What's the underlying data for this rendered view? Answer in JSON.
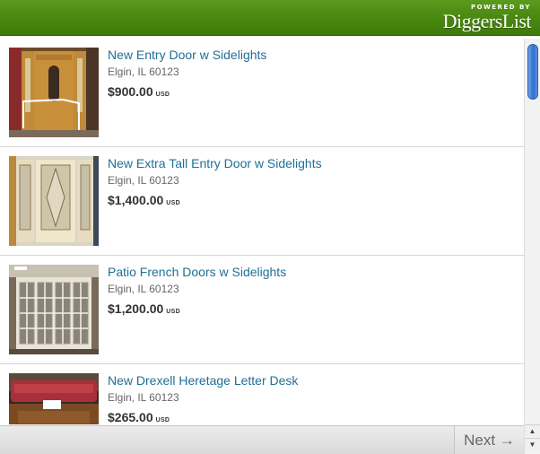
{
  "header": {
    "powered_by": "POWERED BY",
    "logo_text": "DiggersList",
    "bg_color": "#4b8a12"
  },
  "listings": [
    {
      "title": "New Entry Door w Sidelights",
      "location": "Elgin, IL 60123",
      "price": "$900.00",
      "currency": "USD",
      "image": "entry-door-photo"
    },
    {
      "title": "New Extra Tall Entry Door w Sidelights",
      "location": "Elgin, IL 60123",
      "price": "$1,400.00",
      "currency": "USD",
      "image": "tall-entry-door-photo"
    },
    {
      "title": "Patio French Doors w Sidelights",
      "location": "Elgin, IL 60123",
      "price": "$1,200.00",
      "currency": "USD",
      "image": "french-doors-photo"
    },
    {
      "title": "New Drexell Heretage Letter Desk",
      "location": "Elgin, IL 60123",
      "price": "$265.00",
      "currency": "USD",
      "image": "letter-desk-photo"
    }
  ],
  "footer": {
    "next_label": "Next →"
  },
  "scrollbar": {
    "up_icon": "▲",
    "down_icon": "▼"
  },
  "colors": {
    "link": "#1f6f96",
    "scroll_thumb": "#2f6fd0"
  }
}
